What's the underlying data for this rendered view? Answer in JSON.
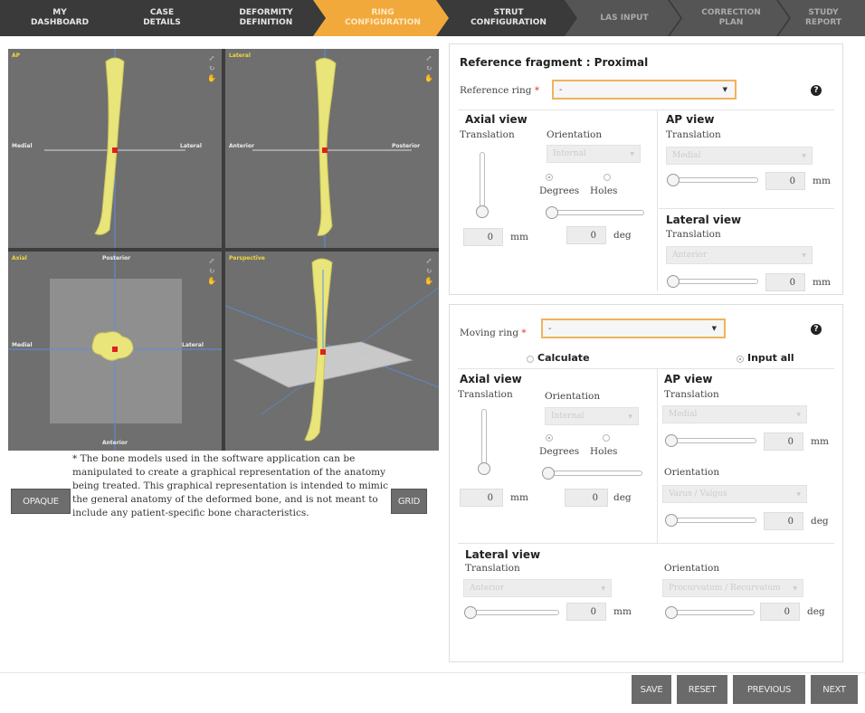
{
  "nav": {
    "steps": [
      {
        "label": "MY\nDASHBOARD"
      },
      {
        "label": "CASE\nDETAILS"
      },
      {
        "label": "DEFORMITY\nDEFINITION"
      },
      {
        "label": "RING\nCONFIGURATION"
      },
      {
        "label": "STRUT\nCONFIGURATION"
      },
      {
        "label": "LAS INPUT"
      },
      {
        "label": "CORRECTION\nPLAN"
      },
      {
        "label": "STUDY\nREPORT"
      }
    ]
  },
  "viewer": {
    "ap": {
      "title": "AP",
      "left": "Medial",
      "right": "Lateral"
    },
    "lateral": {
      "title": "Lateral",
      "left": "Anterior",
      "right": "Posterior"
    },
    "axial": {
      "title": "Axial",
      "top": "Posterior",
      "left": "Medial",
      "right": "Lateral",
      "bottom": "Anterior"
    },
    "perspective": {
      "title": "Perspective"
    }
  },
  "left": {
    "opaque_label": "OPAQUE",
    "grid_label": "GRID",
    "note": "* The bone models used in the software application can be manipulated to create a graphical representation of the anatomy being treated. This graphical representation is intended to mimic the general anatomy of the deformed bone, and is not meant to include any patient-specific bone characteristics."
  },
  "reference": {
    "title": "Reference fragment : Proximal",
    "ring_label": "Reference ring",
    "ring_value": "-",
    "axial_title": "Axial view",
    "translation_label": "Translation",
    "orientation_label": "Orientation",
    "orientation_value": "Internal",
    "degrees_label": "Degrees",
    "holes_label": "Holes",
    "axial_trans_value": "0",
    "axial_trans_unit": "mm",
    "axial_orient_value": "0",
    "axial_orient_unit": "deg",
    "ap_title": "AP view",
    "ap_translation_label": "Translation",
    "ap_select": "Medial",
    "ap_value": "0",
    "ap_unit": "mm",
    "lat_title": "Lateral view",
    "lat_translation_label": "Translation",
    "lat_select": "Anterior",
    "lat_value": "0",
    "lat_unit": "mm"
  },
  "moving": {
    "ring_label": "Moving ring",
    "ring_value": "-",
    "calculate_label": "Calculate",
    "input_all_label": "Input all",
    "axial_title": "Axial view",
    "translation_label": "Translation",
    "orientation_label": "Orientation",
    "orientation_value": "Internal",
    "degrees_label": "Degrees",
    "holes_label": "Holes",
    "axial_trans_value": "0",
    "axial_trans_unit": "mm",
    "axial_orient_value": "0",
    "axial_orient_unit": "deg",
    "ap_title": "AP view",
    "ap_translation_label": "Translation",
    "ap_select": "Medial",
    "ap_value": "0",
    "ap_unit": "mm",
    "ap_orientation_label": "Orientation",
    "ap_orient_select": "Varus / Valgus",
    "ap_orient_value": "0",
    "ap_orient_unit": "deg",
    "lat_title": "Lateral view",
    "lat_translation_label": "Translation",
    "lat_select": "Anterior",
    "lat_value": "0",
    "lat_unit": "mm",
    "lat_orientation_label": "Orientation",
    "lat_orient_select": "Procurvatum / Recurvatum",
    "lat_orient_value": "0",
    "lat_orient_unit": "deg"
  },
  "footer": {
    "save": "SAVE",
    "reset": "RESET",
    "previous": "PREVIOUS",
    "next": "NEXT"
  }
}
